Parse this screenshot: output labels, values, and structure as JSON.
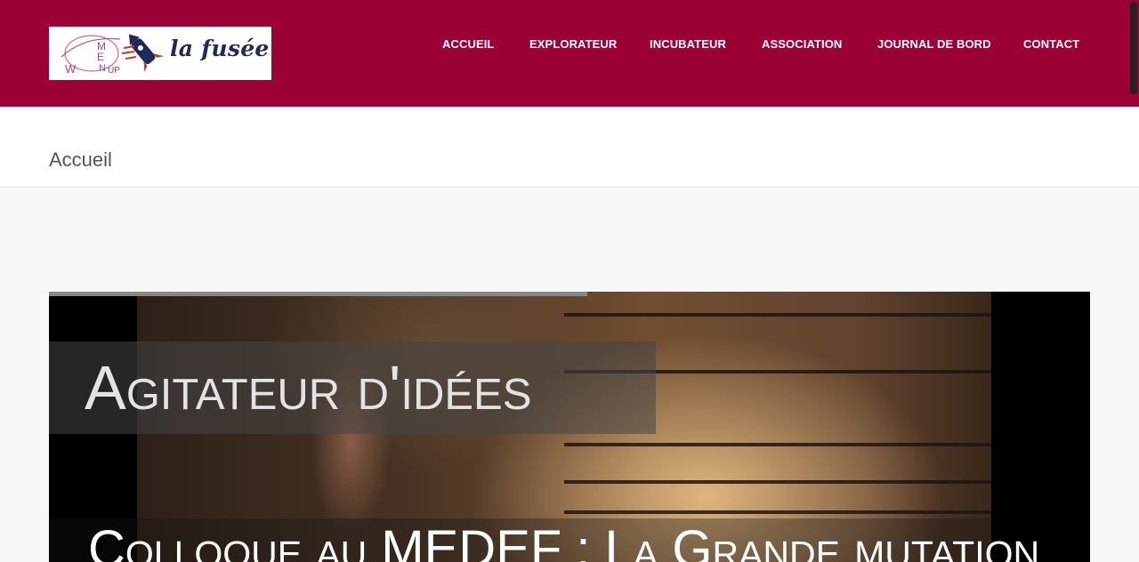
{
  "header": {
    "logo_text": "la fusée",
    "logo_alt": "Women Up la fusée"
  },
  "nav": {
    "items": [
      {
        "label": "ACCUEIL"
      },
      {
        "label": "EXPLORATEUR"
      },
      {
        "label": "INCUBATEUR"
      },
      {
        "label": "ASSOCIATION"
      },
      {
        "label": "JOURNAL DE BORD"
      },
      {
        "label": "CONTACT"
      }
    ]
  },
  "page": {
    "title": "Accueil"
  },
  "slider": {
    "caption": "Agitateur d'idées",
    "subcaption": "Colloque au MEDEF : La Grande mutation",
    "progress": 0.517
  },
  "colors": {
    "brand": "#9c0136",
    "navy": "#1e2a5a"
  }
}
